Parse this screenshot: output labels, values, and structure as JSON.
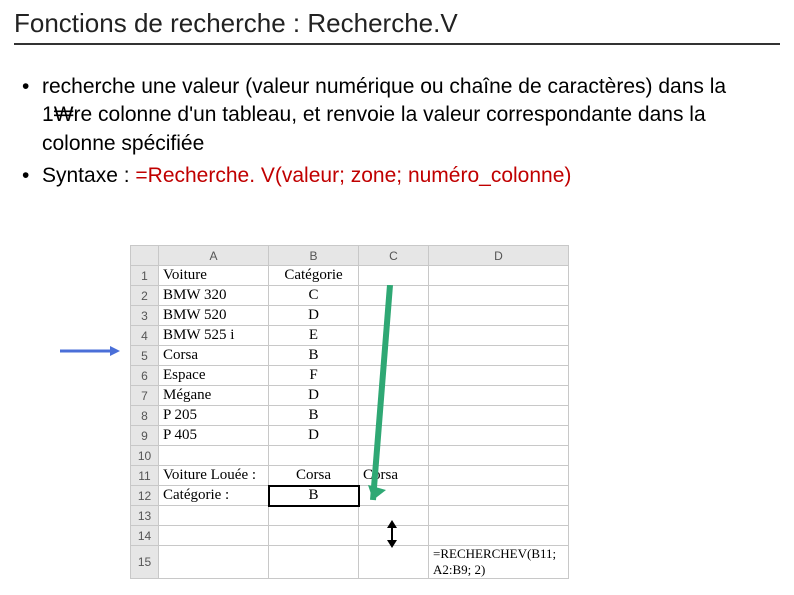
{
  "title": "Fonctions de recherche : Recherche.V",
  "bullet1_part1": "recherche une valeur (valeur numérique ou chaîne de caractères) dans la 1",
  "bullet1_won": "₩",
  "bullet1_part2": "re colonne d'un tableau, et renvoie la valeur correspondante dans la colonne spécifiée",
  "bullet2_lead": "Syntaxe : ",
  "bullet2_red": "=Recherche. V(valeur; zone; numéro_colonne)",
  "columns": {
    "A": "A",
    "B": "B",
    "C": "C",
    "D": "D"
  },
  "rows": [
    "1",
    "2",
    "3",
    "4",
    "5",
    "6",
    "7",
    "8",
    "9",
    "10",
    "11",
    "12",
    "13",
    "14",
    "15"
  ],
  "data": {
    "A1": "Voiture",
    "B1": "Catégorie",
    "A2": "BMW 320",
    "B2": "C",
    "A3": "BMW 520",
    "B3": "D",
    "A4": "BMW 525 i",
    "B4": "E",
    "A5": "Corsa",
    "B5": "B",
    "A6": "Espace",
    "B6": "F",
    "A7": "Mégane",
    "B7": "D",
    "A8": "P 205",
    "B8": "B",
    "A9": "P 405",
    "B9": "D",
    "A11": "Voiture Louée :",
    "B11": "Corsa",
    "C11": "Corsa",
    "A12": "Catégorie :",
    "B12": "B",
    "D15": "=RECHERCHEV(B11; A2:B9; 2)"
  }
}
